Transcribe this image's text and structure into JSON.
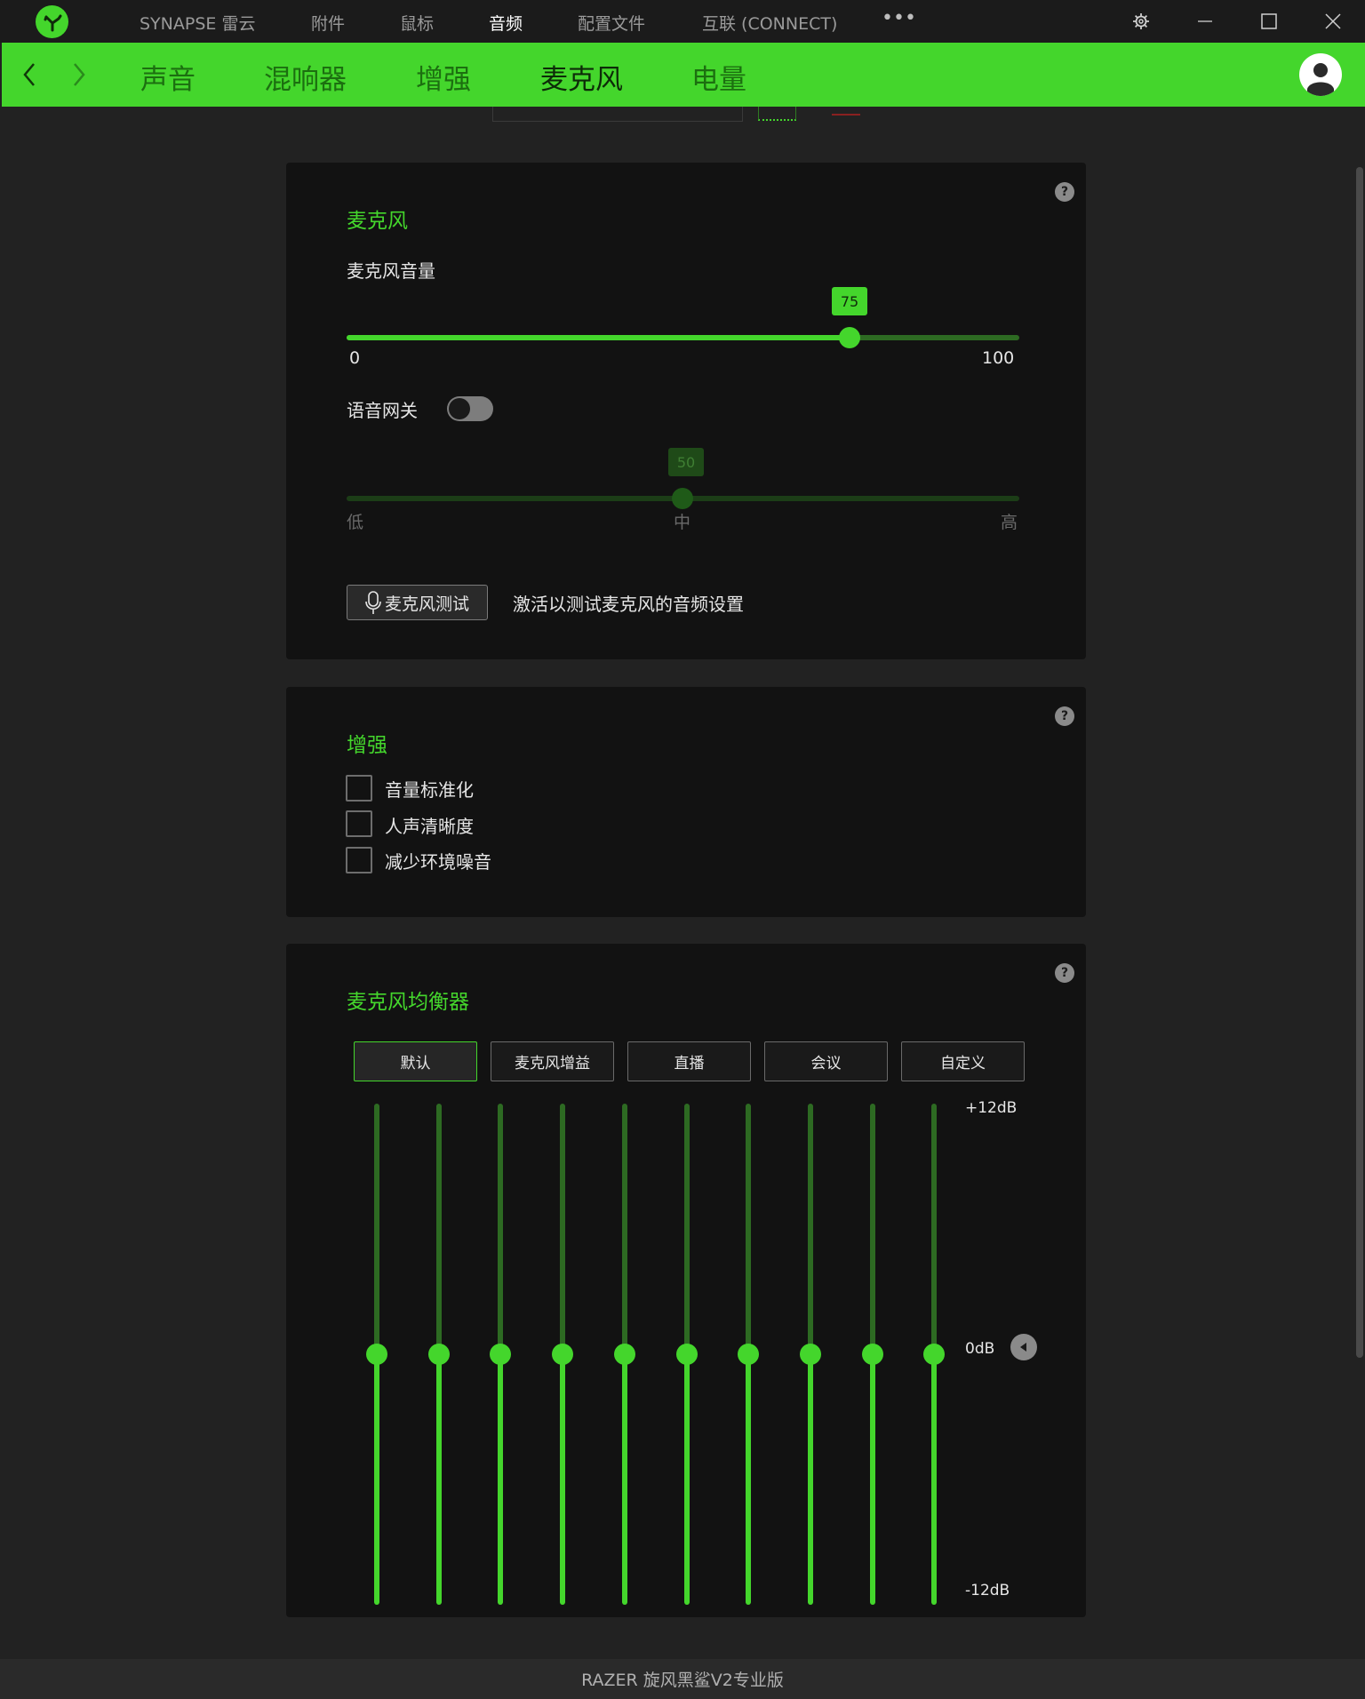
{
  "app": {
    "top_nav": [
      "SYNAPSE 雷云",
      "附件",
      "鼠标",
      "音频",
      "配置文件",
      "互联 (CONNECT)"
    ],
    "active_top_nav": "音频",
    "more_label": "•••"
  },
  "subnav": {
    "tabs": [
      "声音",
      "混响器",
      "增强",
      "麦克风",
      "电量"
    ],
    "active_tab": "麦克风"
  },
  "mic_card": {
    "title": "麦克风",
    "volume_label": "麦克风音量",
    "volume_value": "75",
    "volume_min": "0",
    "volume_max": "100",
    "volume_fraction": 0.75,
    "voice_gate_label": "语音网关",
    "voice_gate_on": false,
    "gate_value": "50",
    "gate_fraction": 0.5,
    "gate_low": "低",
    "gate_mid": "中",
    "gate_high": "高",
    "test_button_label": "麦克风测试",
    "test_description": "激活以测试麦克风的音频设置"
  },
  "enhance_card": {
    "title": "增强",
    "options": [
      {
        "label": "音量标准化",
        "checked": false
      },
      {
        "label": "人声清晰度",
        "checked": false
      },
      {
        "label": "减少环境噪音",
        "checked": false
      }
    ]
  },
  "eq_card": {
    "title": "麦克风均衡器",
    "presets": [
      "默认",
      "麦克风增益",
      "直播",
      "会议",
      "自定义"
    ],
    "active_preset": "默认",
    "max_label": "+12dB",
    "mid_label": "0dB",
    "min_label": "-12dB",
    "bands_db": [
      0,
      0,
      0,
      0,
      0,
      0,
      0,
      0,
      0,
      0
    ]
  },
  "footer": {
    "device_name": "RAZER 旋风黑鲨V2专业版"
  },
  "colors": {
    "accent": "#44d62c",
    "background": "#222222",
    "card": "#121212"
  }
}
